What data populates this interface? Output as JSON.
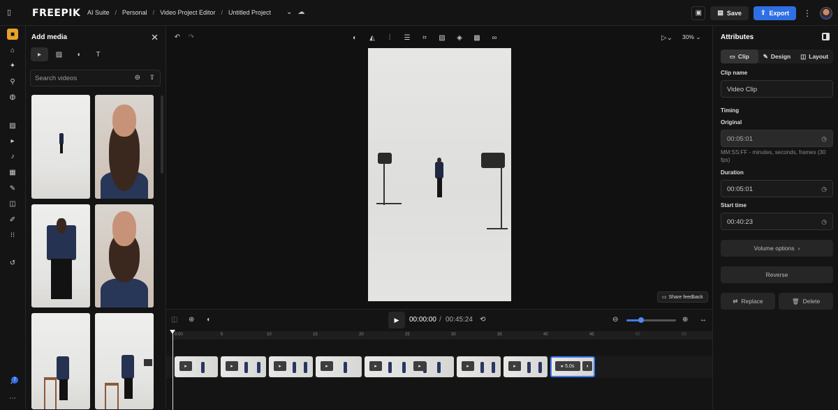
{
  "app": {
    "logo": "FREEPIK",
    "crumbs": [
      "AI Suite",
      "Personal",
      "Video Project Editor",
      "Untitled Project"
    ],
    "crumb_sep": "/"
  },
  "topbar": {
    "save_label": "Save",
    "export_label": "Export"
  },
  "left_panel": {
    "title": "Add media",
    "search_placeholder": "Search videos",
    "media_tabs": [
      "video-icon",
      "image-icon",
      "audio-icon",
      "text-icon"
    ]
  },
  "rail_icons": [
    "brand-kit-icon",
    "home-icon",
    "ai-sparkle-icon",
    "search-icon",
    "globe-icon",
    "image-icon",
    "video-icon",
    "audio-icon",
    "template-icon",
    "edit-icon",
    "effects-icon",
    "brush-icon",
    "apps-icon",
    "history-icon",
    "notifications-icon",
    "more-icon"
  ],
  "notifications_count": "7",
  "canvas": {
    "zoom": "30%",
    "feedback_label": "Share feedback"
  },
  "attributes": {
    "title": "Attributes",
    "tabs": [
      "Clip",
      "Design",
      "Layout"
    ],
    "clip_name_label": "Clip name",
    "clip_name_value": "Video Clip",
    "timing_label": "Timing",
    "original_label": "Original",
    "original_value": "00:05:01",
    "format_hint": "MM:SS:FF - minutes, seconds, frames (30 fps)",
    "duration_label": "Duration",
    "duration_value": "00:05:01",
    "start_label": "Start time",
    "start_value": "00:40:23",
    "volume_label": "Volume options",
    "reverse_label": "Reverse",
    "replace_label": "Replace",
    "delete_label": "Delete"
  },
  "timeline": {
    "current_time": "00:00:00",
    "time_sep": "/",
    "total_time": "00:45:24",
    "zoom_level": 0.3,
    "ruler_ticks": [
      "0:00",
      "5",
      "10",
      "15",
      "20",
      "25",
      "30",
      "35",
      "40",
      "45",
      "50",
      "55"
    ],
    "selected_clip_duration": "5.0s"
  }
}
